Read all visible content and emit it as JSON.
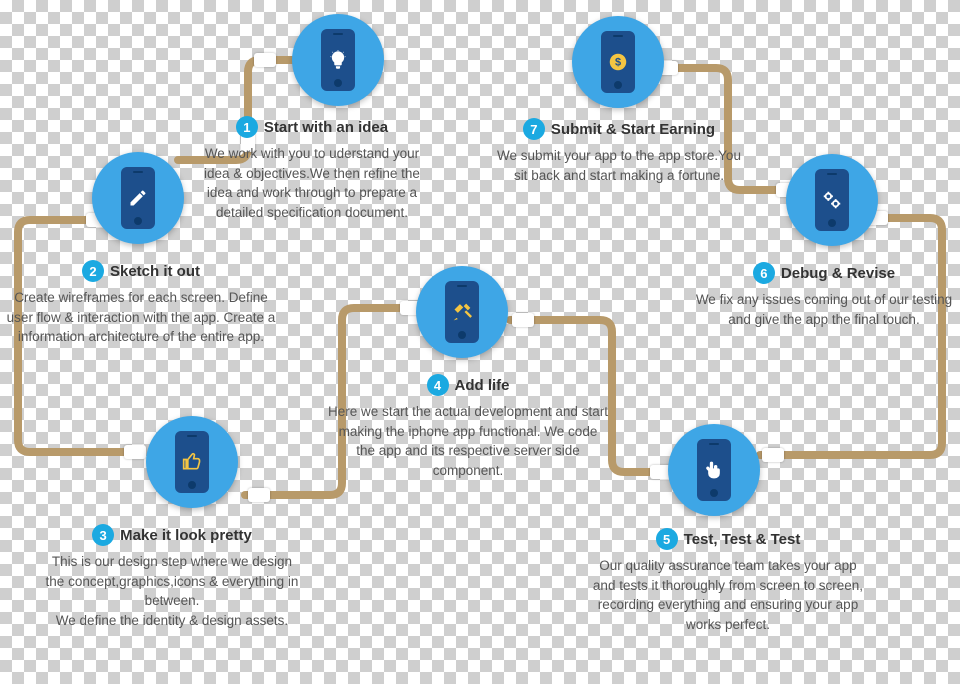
{
  "accent": "#1ba9e1",
  "nodeColor": "#3ea6e6",
  "phoneColor": "#1d4f8c",
  "steps": [
    {
      "n": "1",
      "title": "Start with an idea",
      "desc": "We work with you to uderstand your idea & objectives.We then refine the idea and work through to prepare a detailed specification document.",
      "icon": "lightbulb"
    },
    {
      "n": "2",
      "title": "Sketch it out",
      "desc": "Create wireframes for each screen. Define user flow & interaction with the app. Create a information architecture of the entire app.",
      "icon": "pencil"
    },
    {
      "n": "3",
      "title": "Make it look pretty",
      "desc": "This is our design step where we design the concept,graphics,icons & everything in between.\nWe define the identity & design assets.",
      "icon": "thumbs-up"
    },
    {
      "n": "4",
      "title": "Add life",
      "desc": "Here we start the actual development and start making the iphone app functional. We code the app and its respective server side component.",
      "icon": "tools"
    },
    {
      "n": "5",
      "title": "Test, Test & Test",
      "desc": "Our quality assurance team takes your app and tests it thoroughly from screen to screen, recording everything and ensuring your app works perfect.",
      "icon": "pointer"
    },
    {
      "n": "6",
      "title": "Debug & Revise",
      "desc": "We fix any issues coming out of our testing and give the app the final touch.",
      "icon": "gears"
    },
    {
      "n": "7",
      "title": "Submit & Start Earning",
      "desc": "We submit your app to the app store.You sit back and start making a fortune.",
      "icon": "dollar-badge"
    }
  ]
}
